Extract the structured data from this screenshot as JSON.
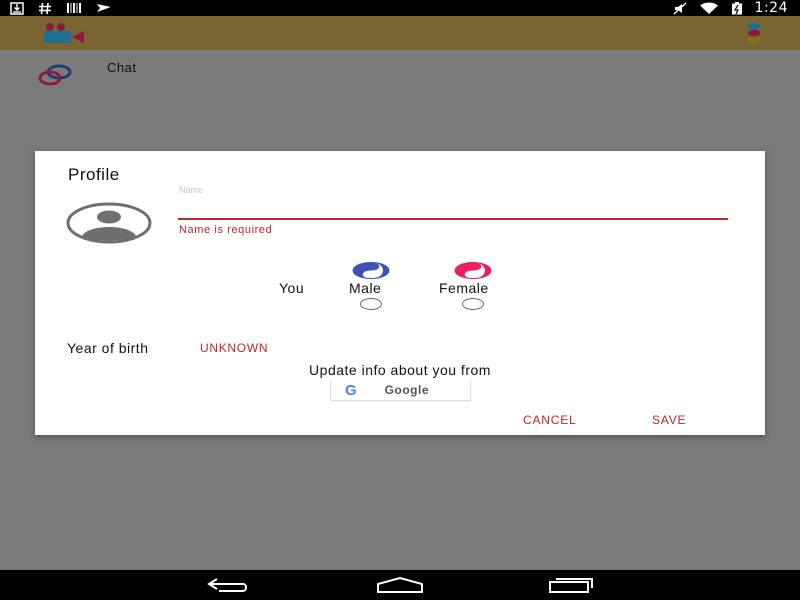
{
  "status_bar": {
    "time": "1:24",
    "left_icons": [
      "download-icon",
      "hash-icon",
      "barcode-icon",
      "plane-icon"
    ],
    "right_icons": [
      "mute-icon",
      "wifi-icon",
      "battery-icon"
    ]
  },
  "app_bar": {
    "logo_icon": "video-chat-logo-icon",
    "menu_icon": "colored-dots-menu-icon"
  },
  "list": {
    "chat_label": "Chat",
    "chat_icon": "chat-bubbles-icon"
  },
  "dialog": {
    "title": "Profile",
    "avatar_icon": "avatar-icon",
    "name_placeholder": "Name",
    "name_value": "",
    "name_error": "Name is required",
    "gender": {
      "you_label": "You",
      "male_label": "Male",
      "female_label": "Female",
      "male_icon": "yin-yang-blue-icon",
      "female_icon": "yin-yang-pink-icon",
      "selected": null
    },
    "year_of_birth_label": "Year of birth",
    "year_of_birth_value": "UNKNOWN",
    "update_info_label": "Update info about you from",
    "google_button_label": "Google",
    "google_logo": "G",
    "cancel_label": "CANCEL",
    "save_label": "SAVE"
  },
  "nav_bar": {
    "icons": [
      "back-icon",
      "home-icon",
      "recents-icon"
    ]
  },
  "colors": {
    "accent_red": "#c1262c",
    "male_blue": "#3f51b5",
    "female_pink": "#e91e63",
    "app_bar_dimmed": "#7a6432",
    "scrim_gray": "#7b7b7b"
  }
}
